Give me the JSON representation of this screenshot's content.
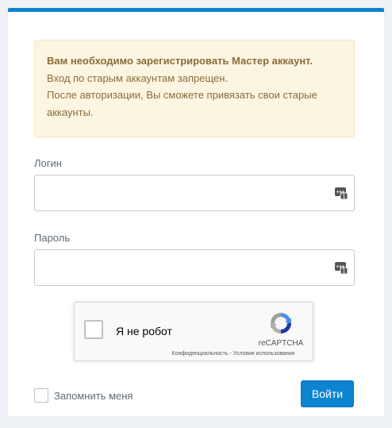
{
  "alert": {
    "title": "Вам необходимо зарегистрировать Мастер аккаунт.",
    "line1": "Вход по старым аккаунтам запрещен.",
    "line2": "После авторизации, Вы сможете привязать свои старые",
    "line3": "аккаунты."
  },
  "form": {
    "login_label": "Логин",
    "login_value": "",
    "login_icon": "password-manager-icon",
    "password_label": "Пароль",
    "password_value": "",
    "password_icon": "password-manager-icon",
    "remember_label": "Запомнить меня",
    "remember_checked": false,
    "submit_label": "Войти"
  },
  "recaptcha": {
    "label": "Я не робот",
    "brand": "reCAPTCHA",
    "terms": "Конфиденциальность - Условия использования",
    "logo_icon": "recaptcha-logo-icon"
  },
  "colors": {
    "accent": "#0d84cf",
    "alert_bg": "#fcf5e2",
    "alert_text": "#8a6d3b"
  }
}
